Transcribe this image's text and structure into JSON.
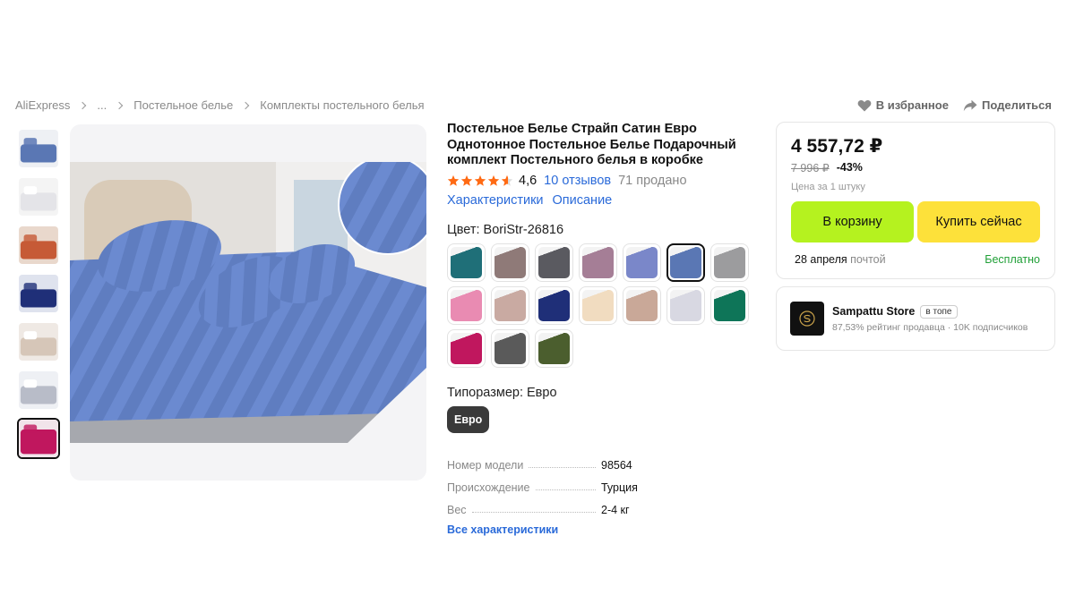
{
  "breadcrumb": {
    "items": [
      "AliExpress",
      "...",
      "Постельное белье",
      "Комплекты постельного белья"
    ]
  },
  "top_actions": {
    "favorite": "В избранное",
    "share": "Поделиться"
  },
  "product": {
    "title": "Постельное Белье Страйп Сатин Евро Однотонное Постельное Белье Подарочный комплект Постельного белья в коробке",
    "rating": "4,6",
    "rating_value": 4.6,
    "reviews": "10 отзывов",
    "sold": "71 продано",
    "tab_characteristics": "Характеристики",
    "tab_description": "Описание",
    "color_label": "Цвет: BoriStr-26816",
    "size_label": "Типоразмер: Евро",
    "size_option": "Евро",
    "specs": [
      {
        "key": "Номер модели",
        "value": "98564"
      },
      {
        "key": "Происхождение",
        "value": "Турция"
      },
      {
        "key": "Вес",
        "value": "2-4 кг"
      }
    ],
    "all_specs": "Все характеристики"
  },
  "swatch_colors": [
    "#1f6f78",
    "#8f7a78",
    "#5a5a60",
    "#a57e96",
    "#7a87c9",
    "#5a77b4",
    "#9c9c9e",
    "#e98bb2",
    "#c9aaa2",
    "#1f2f78",
    "#f1dcc0",
    "#c9a898",
    "#d8d8e2",
    "#0e7558",
    "#c0175e",
    "#5a5a5a",
    "#4b5e2e"
  ],
  "thumb_colors": [
    "#5a77b4",
    "#e4e4e8",
    "#c65a36",
    "#1f2f78",
    "#d6c6b8",
    "#b8bcc8",
    "#c0175e"
  ],
  "buybox": {
    "price": "4 557,72 ₽",
    "old_price": "7 996 ₽",
    "discount": "-43%",
    "unit_note": "Цена за 1 штуку",
    "add_to_cart": "В корзину",
    "buy_now": "Купить сейчас",
    "delivery_date": "28 апреля",
    "delivery_mode": "почтой",
    "delivery_price": "Бесплатно"
  },
  "store": {
    "name": "Sampattu Store",
    "badge": "в топе",
    "meta": "87,53% рейтинг продавца · 10K подписчиков"
  }
}
